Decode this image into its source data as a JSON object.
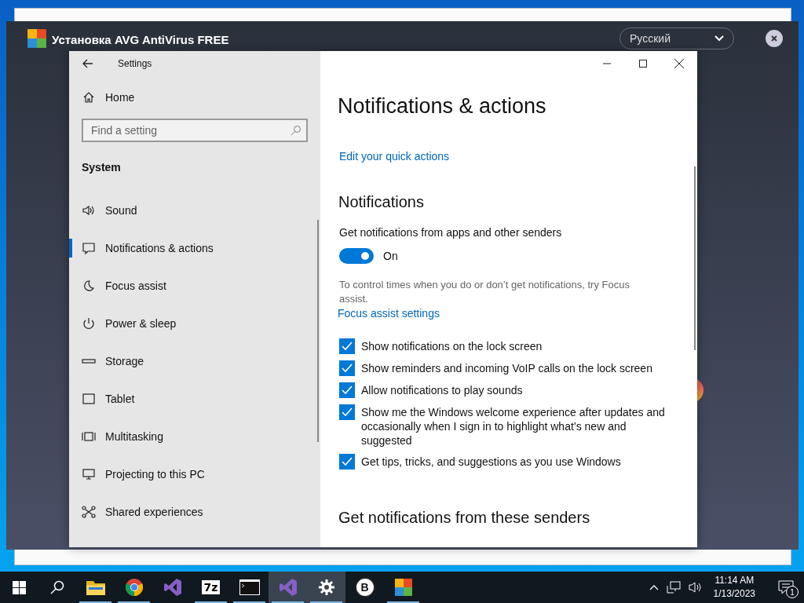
{
  "installer": {
    "title": "Установка AVG AntiVirus FREE",
    "language": "Русский"
  },
  "settings": {
    "title": "Settings",
    "home": "Home",
    "search": {
      "placeholder": "Find a setting"
    },
    "section": "System",
    "nav": [
      {
        "kind": "sound",
        "label": "Sound",
        "selected": false
      },
      {
        "kind": "notifications",
        "label": "Notifications & actions",
        "selected": true
      },
      {
        "kind": "focus",
        "label": "Focus assist",
        "selected": false
      },
      {
        "kind": "power",
        "label": "Power & sleep",
        "selected": false
      },
      {
        "kind": "storage",
        "label": "Storage",
        "selected": false
      },
      {
        "kind": "tablet",
        "label": "Tablet",
        "selected": false
      },
      {
        "kind": "multitasking",
        "label": "Multitasking",
        "selected": false
      },
      {
        "kind": "projecting",
        "label": "Projecting to this PC",
        "selected": false
      },
      {
        "kind": "shared",
        "label": "Shared experiences",
        "selected": false
      }
    ],
    "page_title": "Notifications & actions",
    "quick_actions_link": "Edit your quick actions",
    "notifications_heading": "Notifications",
    "toggle": {
      "label": "Get notifications from apps and other senders",
      "on": true,
      "state_text": "On"
    },
    "hint": "To control times when you do or don’t get notifications, try Focus assist.",
    "focus_link": "Focus assist settings",
    "options": [
      {
        "label": "Show notifications on the lock screen",
        "checked": true
      },
      {
        "label": "Show reminders and incoming VoIP calls on the lock screen",
        "checked": true
      },
      {
        "label": "Allow notifications to play sounds",
        "checked": true
      },
      {
        "label": "Show me the Windows welcome experience after updates and occasionally when I sign in to highlight what’s new and suggested",
        "checked": true
      },
      {
        "label": "Get tips, tricks, and suggestions as you use Windows",
        "checked": true
      }
    ],
    "senders_heading": "Get notifications from these senders"
  },
  "taskbar": {
    "apps": [
      {
        "kind": "folder",
        "running": true,
        "active": false
      },
      {
        "kind": "chrome",
        "running": true,
        "active": false
      },
      {
        "kind": "vs",
        "running": false,
        "active": false
      },
      {
        "kind": "archiver",
        "label": "7z",
        "running": true,
        "active": false
      },
      {
        "kind": "terminal",
        "running": true,
        "active": false
      },
      {
        "kind": "vs",
        "running": true,
        "active": true
      },
      {
        "kind": "gear",
        "running": true,
        "active": true
      },
      {
        "kind": "b",
        "label": "B",
        "running": false,
        "active": false
      },
      {
        "kind": "avg",
        "running": true,
        "active": false
      }
    ],
    "time": "11:14 AM",
    "date": "1/13/2023",
    "notification_count": "1"
  }
}
